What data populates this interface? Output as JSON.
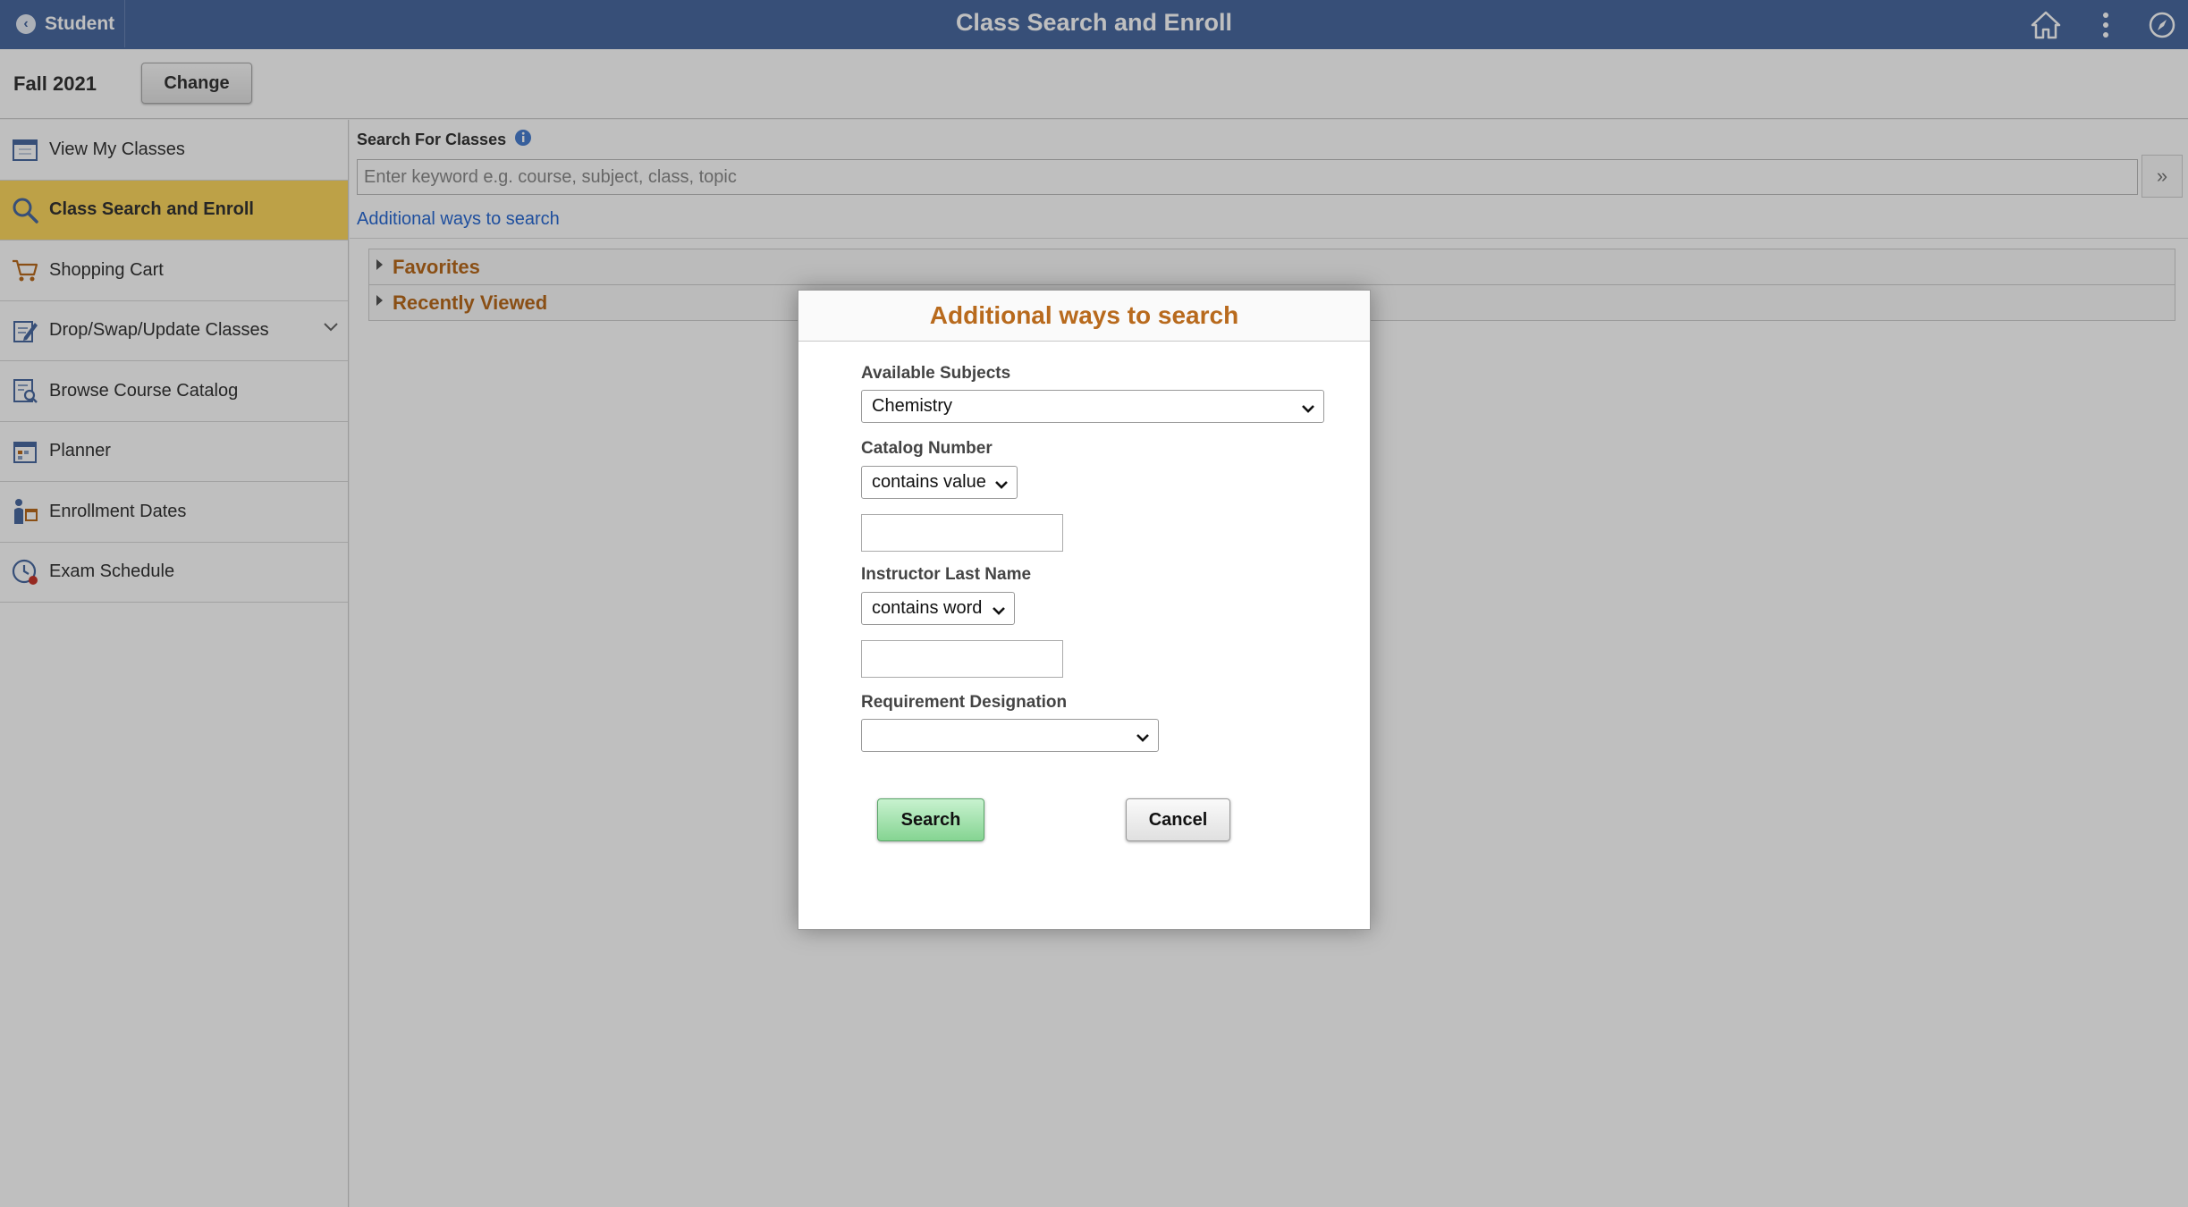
{
  "header": {
    "back_label": "Student",
    "title": "Class Search and Enroll",
    "icons": [
      "home-icon",
      "more-vertical-icon",
      "compass-icon"
    ]
  },
  "term": {
    "label": "Fall 2021",
    "change_label": "Change"
  },
  "sidebar": {
    "items": [
      {
        "label": "View My Classes",
        "icon": "calendar-icon",
        "active": false
      },
      {
        "label": "Class Search and Enroll",
        "icon": "search-icon",
        "active": true
      },
      {
        "label": "Shopping Cart",
        "icon": "cart-icon",
        "active": false
      },
      {
        "label": "Drop/Swap/Update Classes",
        "icon": "edit-document-icon",
        "active": false,
        "expandable": true
      },
      {
        "label": "Browse Course Catalog",
        "icon": "catalog-icon",
        "active": false
      },
      {
        "label": "Planner",
        "icon": "planner-icon",
        "active": false
      },
      {
        "label": "Enrollment Dates",
        "icon": "enrollment-dates-icon",
        "active": false
      },
      {
        "label": "Exam Schedule",
        "icon": "clock-icon",
        "active": false
      }
    ]
  },
  "main": {
    "search_label": "Search For Classes",
    "search_placeholder": "Enter keyword e.g. course, subject, class, topic",
    "go_label": "»",
    "additional_link": "Additional ways to search",
    "sections": [
      {
        "label": "Favorites"
      },
      {
        "label": "Recently Viewed"
      }
    ]
  },
  "modal": {
    "title": "Additional ways to search",
    "subjects_label": "Available Subjects",
    "subjects_value": "Chemistry",
    "catalog_label": "Catalog Number",
    "catalog_operator": "contains value",
    "catalog_value": "",
    "instructor_label": "Instructor Last Name",
    "instructor_operator": "contains word",
    "instructor_value": "",
    "requirement_label": "Requirement Designation",
    "requirement_value": "",
    "search_button": "Search",
    "cancel_button": "Cancel"
  },
  "colors": {
    "header_bg": "#4a6aa0",
    "active_nav": "#fdd75f",
    "accent_orange": "#b86a1d",
    "link_blue": "#2a6ad3",
    "search_button": "#85d492"
  }
}
